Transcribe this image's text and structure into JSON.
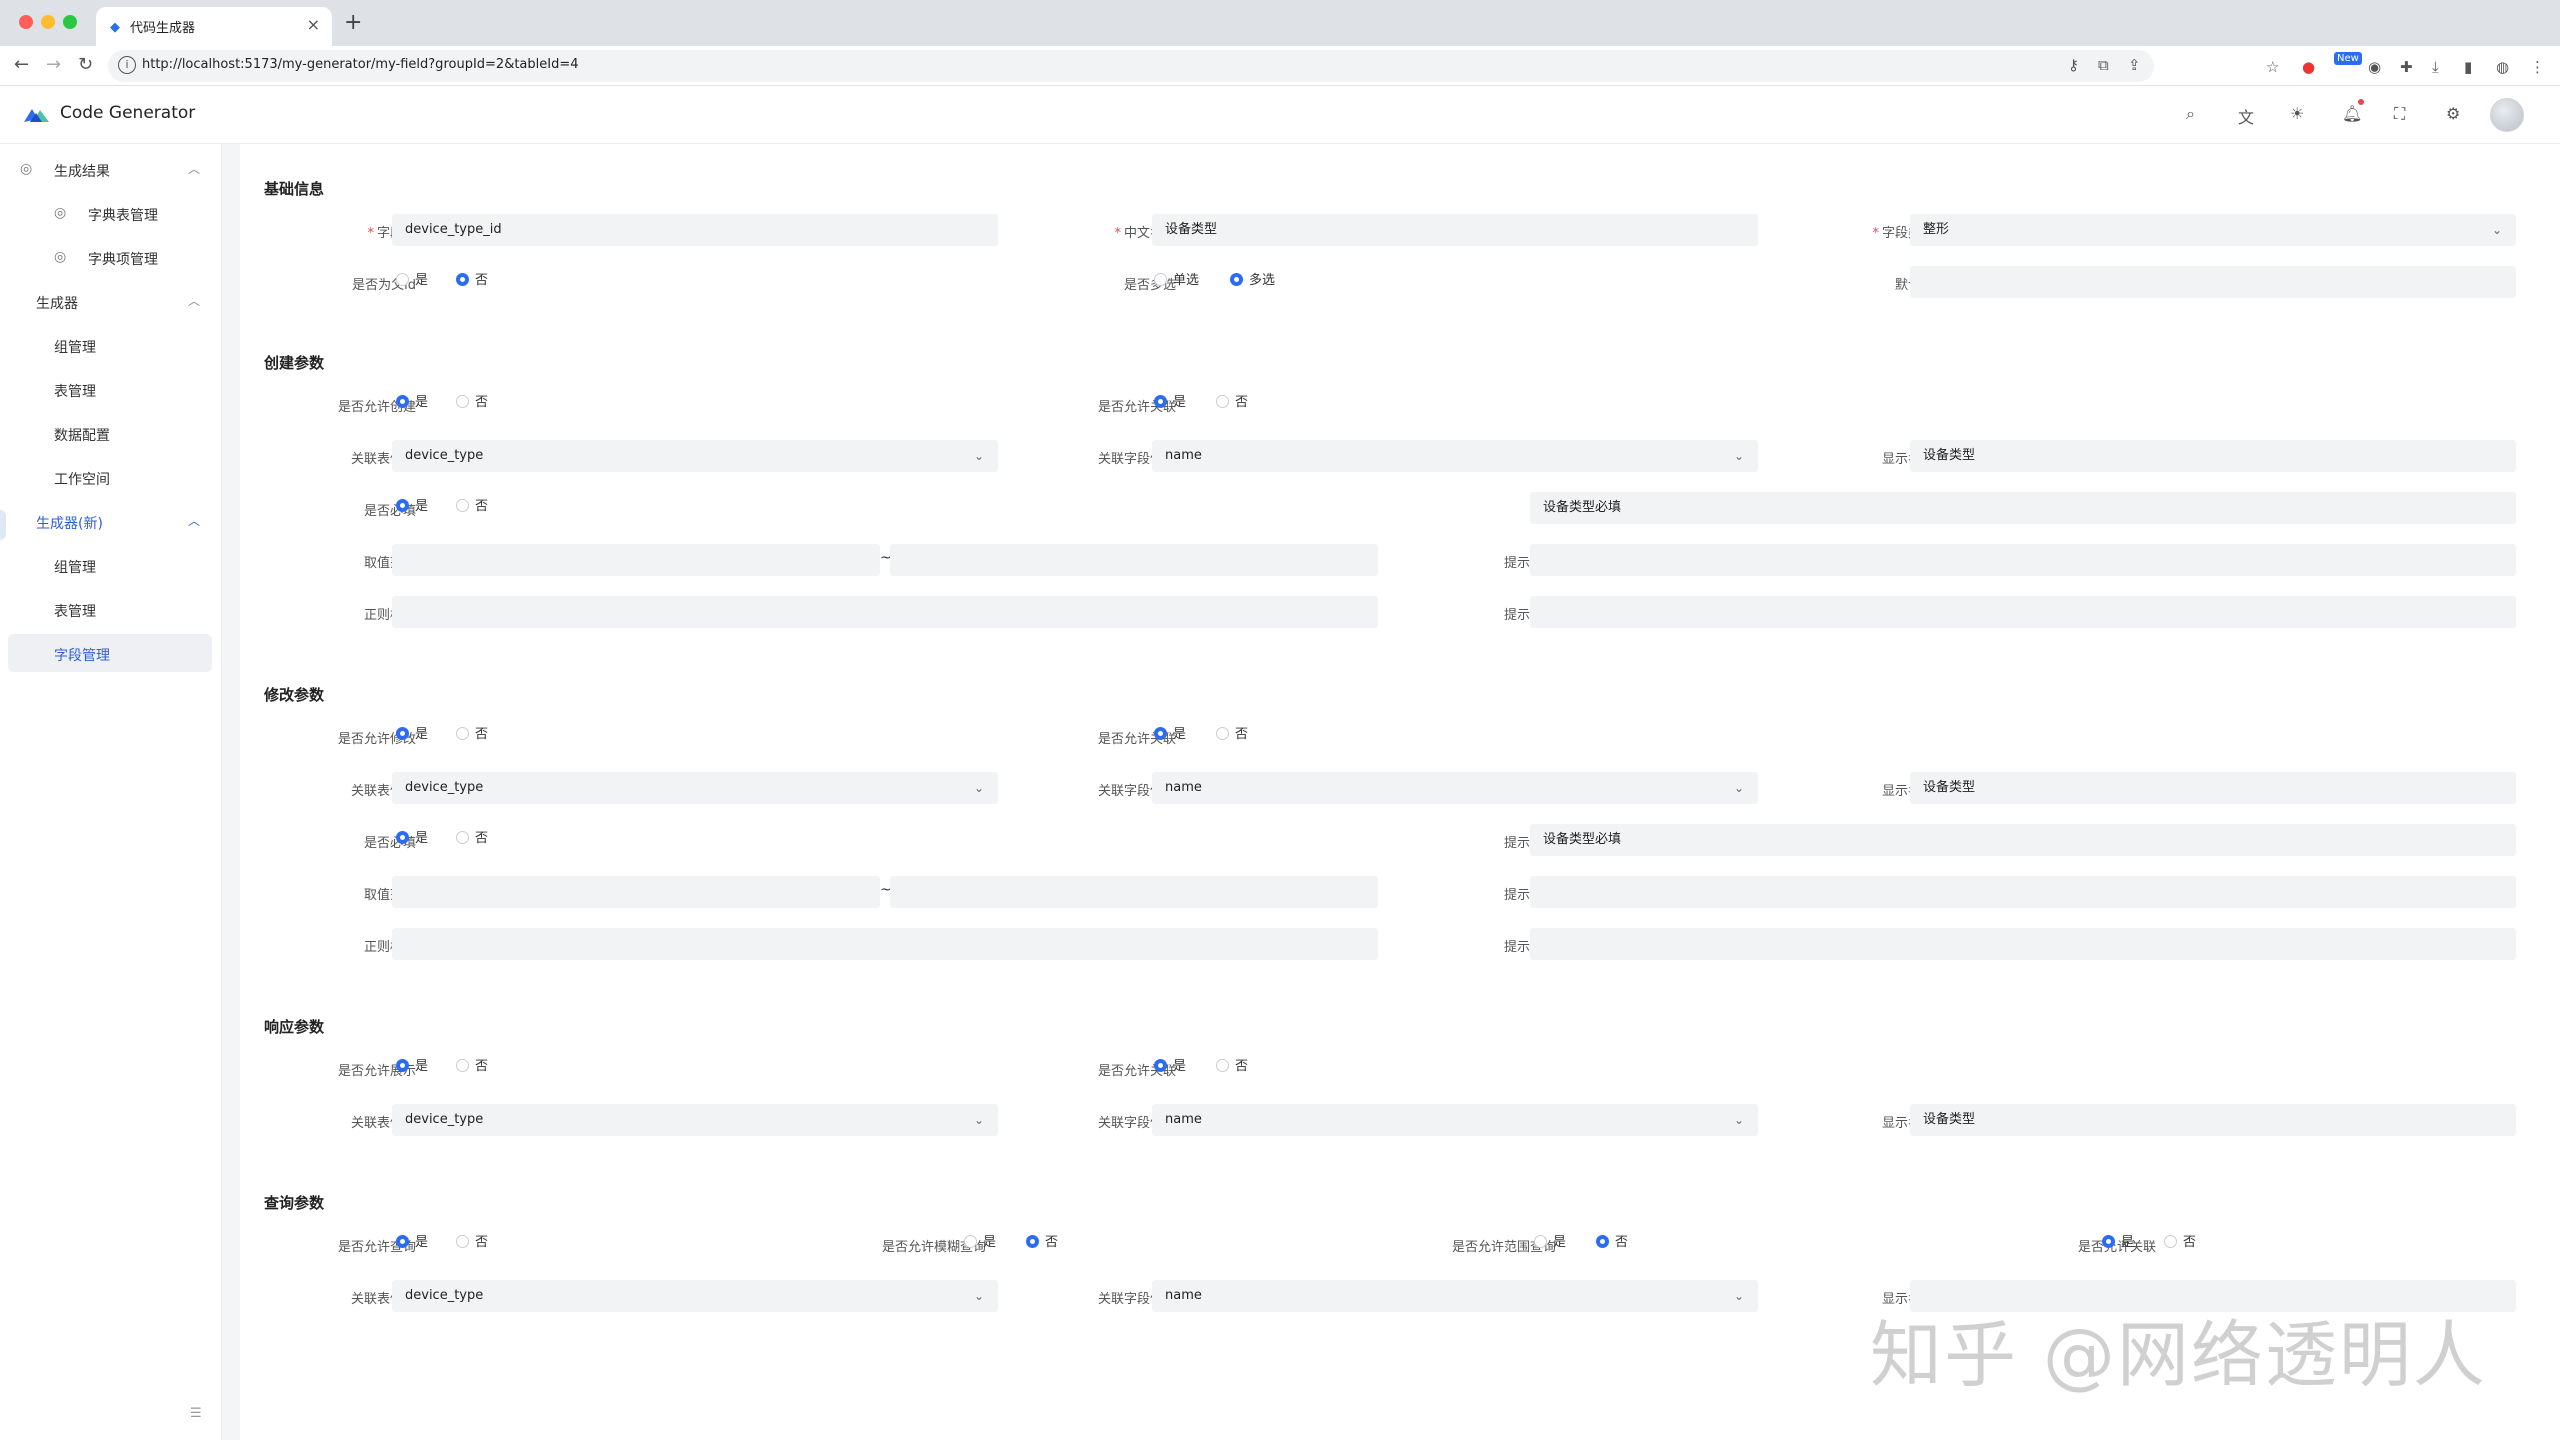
{
  "browser": {
    "tab_title": "代码生成器",
    "url": "http://localhost:5173/my-generator/my-field?groupId=2&tableId=4",
    "new_badge": "New"
  },
  "app": {
    "brand": "Code Generator"
  },
  "sidebar": {
    "groups": [
      {
        "label": "生成结果",
        "items": [
          "字典表管理",
          "字典项管理"
        ]
      },
      {
        "label": "生成器",
        "items": [
          "组管理",
          "表管理",
          "数据配置",
          "工作空间"
        ]
      },
      {
        "label": "生成器(新)",
        "items": [
          "组管理",
          "表管理",
          "字段管理"
        ]
      }
    ]
  },
  "form": {
    "basic": {
      "title": "基础信息",
      "field_name_label": "字段名",
      "field_name_value": "device_type_id",
      "cn_name_label": "中文名称",
      "cn_name_value": "设备类型",
      "field_type_label": "字段类型",
      "field_type_value": "整形",
      "is_parent_label": "是否为父id",
      "multi_label": "是否多选",
      "single_opt": "单选",
      "multi_opt": "多选",
      "default_label": "默认值"
    },
    "create": {
      "title": "创建参数",
      "allow_label": "是否允许创建",
      "allow_assoc_label": "是否允许关联",
      "table_label": "关联表信息",
      "table_value": "device_type",
      "field_label": "关联字段信息",
      "field_value": "name",
      "display_label": "显示名称",
      "display_value": "设备类型",
      "required_label": "是否必填",
      "hint_label": "提示信息",
      "hint_value": "设备类型必填",
      "range_label": "取值范围",
      "regex_label": "正则校验",
      "tilde": "~"
    },
    "update": {
      "title": "修改参数",
      "allow_label": "是否允许修改",
      "allow_assoc_label": "是否允许关联",
      "table_label": "关联表信息",
      "table_value": "device_type",
      "field_label": "关联字段信息",
      "field_value": "name",
      "display_label": "显示名称",
      "display_value": "设备类型",
      "required_label": "是否必填",
      "hint_label": "提示信息",
      "hint_value": "设备类型必填",
      "range_label": "取值范围",
      "regex_label": "正则校验",
      "tilde": "~"
    },
    "response": {
      "title": "响应参数",
      "allow_label": "是否允许展示",
      "allow_assoc_label": "是否允许关联",
      "table_label": "关联表信息",
      "table_value": "device_type",
      "field_label": "关联字段信息",
      "field_value": "name",
      "display_label": "显示名称",
      "display_value": "设备类型"
    },
    "query": {
      "title": "查询参数",
      "allow_label": "是否允许查询",
      "fuzzy_label": "是否允许模糊查询",
      "range_label": "是否允许范围查询",
      "allow_assoc_label": "是否允许关联",
      "table_label": "关联表信息",
      "table_value": "device_type",
      "field_label": "关联字段信息",
      "field_value": "name",
      "display_label": "显示名称"
    },
    "yes": "是",
    "no": "否"
  },
  "watermark": "知乎 @网络透明人",
  "colors": {
    "primary": "#2b6cf0",
    "input_bg": "#f2f3f5",
    "required": "#e5484d"
  }
}
